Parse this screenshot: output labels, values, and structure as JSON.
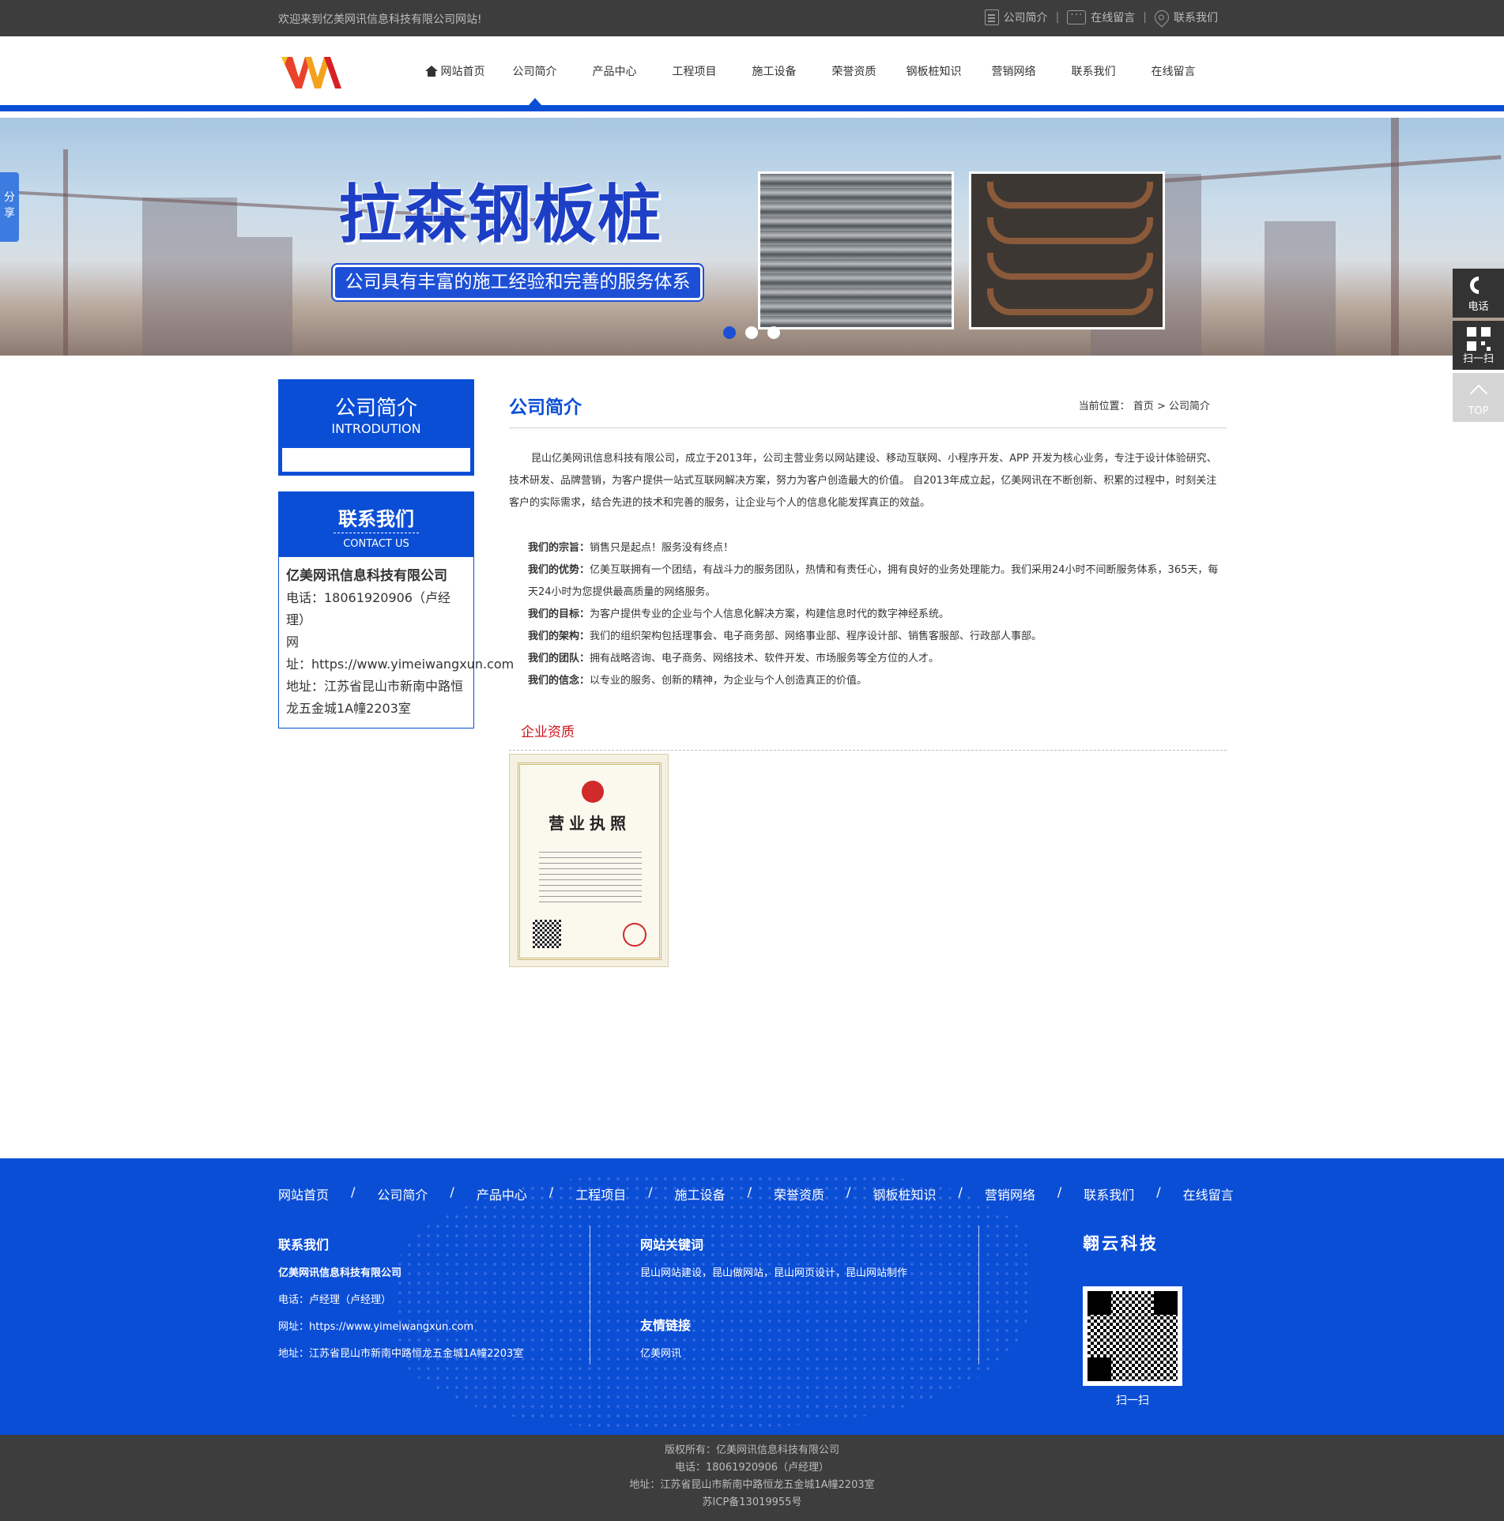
{
  "topbar": {
    "welcome": "欢迎来到亿美网讯信息科技有限公司网站!",
    "links": [
      {
        "label": "公司简介",
        "icon": "document-icon"
      },
      {
        "label": "在线留言",
        "icon": "chat-icon"
      },
      {
        "label": "联系我们",
        "icon": "location-pin-icon"
      }
    ],
    "separator": "|"
  },
  "nav": {
    "items": [
      "网站首页",
      "公司简介",
      "产品中心",
      "工程项目",
      "施工设备",
      "荣誉资质",
      "钢板桩知识",
      "营销网络",
      "联系我们",
      "在线留言"
    ],
    "active_index": 1
  },
  "banner": {
    "title": "拉森钢板桩",
    "subtitle": "公司具有丰富的施工经验和完善的服务体系",
    "slide_count": 3,
    "active_slide": 0
  },
  "share": {
    "label": "分享"
  },
  "float_tools": {
    "phone": "电话",
    "qr": "扫一扫",
    "top": "TOP"
  },
  "sidebar": {
    "intro": {
      "title": "公司简介",
      "subtitle": "INTRODUTION"
    },
    "contact": {
      "title": "联系我们",
      "subtitle": "CONTACT US",
      "company": "亿美网讯信息科技有限公司",
      "phone": "电话：18061920906（卢经理）",
      "web_label": "网",
      "web": "址：https://www.yimeiwangxun.com",
      "address": "地址：江苏省昆山市新南中路恒龙五金城1A幢2203室"
    }
  },
  "main": {
    "title": "公司简介",
    "breadcrumb_label": "当前位置：",
    "breadcrumb_home": "首页",
    "breadcrumb_sep": ">",
    "breadcrumb_current": "公司简介",
    "paragraph": "昆山亿美网讯信息科技有限公司，成立于2013年，公司主营业务以网站建设、移动互联网、小程序开发、APP 开发为核心业务，专注于设计体验研究、技术研发、品牌营销，为客户提供一站式互联网解决方案，努力为客户创造最大的价值。 自2013年成立起，亿美网讯在不断创新、积累的过程中，时刻关注客户的实际需求，结合先进的技术和完善的服务，让企业与个人的信息化能发挥真正的效益。",
    "items": [
      {
        "label": "我们的宗旨：",
        "text": "销售只是起点！服务没有终点！"
      },
      {
        "label": "我们的优势：",
        "text": "亿美互联拥有一个团结，有战斗力的服务团队，热情和有责任心，拥有良好的业务处理能力。我们采用24小时不间断服务体系，365天，每天24小时为您提供最高质量的网络服务。"
      },
      {
        "label": "我们的目标：",
        "text": "为客户提供专业的企业与个人信息化解决方案，构建信息时代的数字神经系统。"
      },
      {
        "label": "我们的架构：",
        "text": "我们的组织架构包括理事会、电子商务部、网络事业部、程序设计部、销售客服部、行政部人事部。"
      },
      {
        "label": "我们的团队：",
        "text": "拥有战略咨询、电子商务、网络技术、软件开发、市场服务等全方位的人才。"
      },
      {
        "label": "我们的信念：",
        "text": "以专业的服务、创新的精神，为企业与个人创造真正的价值。"
      }
    ],
    "cert_title": "企业资质",
    "cert_label": "营业执照"
  },
  "footer": {
    "nav": [
      "网站首页",
      "公司简介",
      "产品中心",
      "工程项目",
      "施工设备",
      "荣誉资质",
      "钢板桩知识",
      "营销网络",
      "联系我们",
      "在线留言"
    ],
    "nav_sep": "/",
    "contact": {
      "title": "联系我们",
      "company": "亿美网讯信息科技有限公司",
      "phone": "电话：卢经理（卢经理）",
      "web": "网址：https://www.yimeiwangxun.com",
      "address": "地址：江苏省昆山市新南中路恒龙五金城1A幢2203室"
    },
    "keywords": {
      "title": "网站关键词",
      "text": "昆山网站建设，昆山做网站，昆山网页设计，昆山网站制作"
    },
    "friends": {
      "title": "友情链接",
      "link": "亿美网讯"
    },
    "brand": "翱云科技",
    "qr_label": "扫一扫"
  },
  "bottom": {
    "copyright": "版权所有：亿美网讯信息科技有限公司",
    "phone": "电话：18061920906（卢经理）",
    "address": "地址：江苏省昆山市新南中路恒龙五金城1A幢2203室",
    "icp": "苏ICP备13019955号"
  },
  "colors": {
    "brand_blue": "#0b4ed6",
    "dark_bar": "#3d3d3d",
    "accent_red": "#d0141d"
  }
}
